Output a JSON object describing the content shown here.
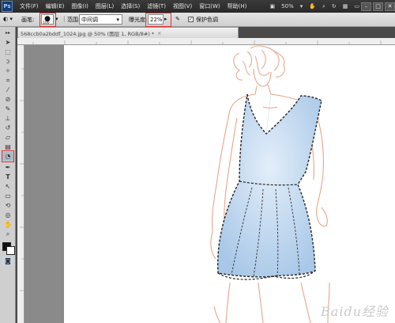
{
  "app": {
    "logo": "Ps"
  },
  "menu": [
    "文件(F)",
    "编辑(E)",
    "图像(I)",
    "图层(L)",
    "选择(S)",
    "滤镜(T)",
    "视图(V)",
    "窗口(W)",
    "帮助(H)"
  ],
  "menu_right": {
    "zoom": "50%"
  },
  "options": {
    "brush_label": "画笔:",
    "brush_size": "100",
    "range_label": "范围:",
    "range_value": "中间调",
    "exposure_label": "曝光度:",
    "exposure_value": "22%",
    "protect_label": "保护色调"
  },
  "document": {
    "tab_title": "568ccb0a2bddf_1024.jpg @ 50% (图层 1, RGB/8#) *"
  },
  "watermark": "Baidu经验",
  "colors": {
    "dress": "#bcd6ee",
    "sketch": "#e9a58a",
    "highlight": "#e0302c"
  }
}
